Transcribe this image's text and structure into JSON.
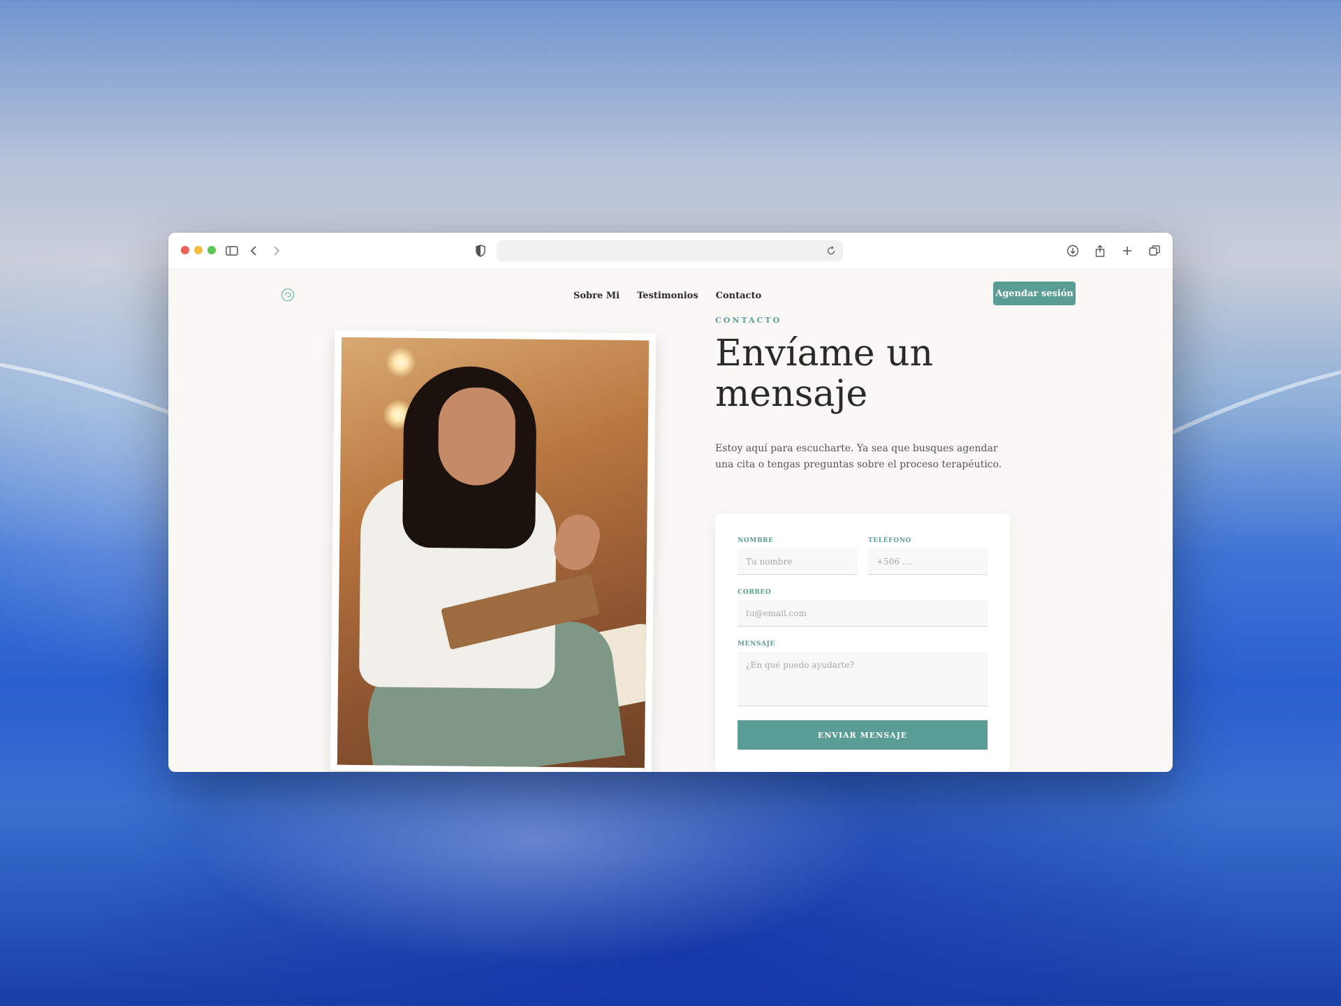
{
  "browser": {
    "url": "",
    "icons": [
      "sidebar-icon",
      "back-icon",
      "forward-icon",
      "shield-icon",
      "reload-icon",
      "download-icon",
      "share-icon",
      "new-tab-icon",
      "tabs-overview-icon"
    ]
  },
  "site": {
    "nav": [
      "Sobre Mi",
      "Testimonios",
      "Contacto"
    ],
    "cta_label": "Agendar sesión",
    "brand_color": "#5a9d95"
  },
  "contact": {
    "kicker": "CONTACTO",
    "title": "Envíame un mensaje",
    "intro": "Estoy aquí para escucharte. Ya sea que busques agendar una cita o tengas preguntas sobre el proceso terapéutico."
  },
  "form": {
    "name": {
      "label": "NOMBRE",
      "placeholder": "Tu nombre",
      "value": ""
    },
    "phone": {
      "label": "TELÉFONO",
      "placeholder": "+506 ....",
      "value": ""
    },
    "email": {
      "label": "CORREO",
      "placeholder": "tu@email.com",
      "value": ""
    },
    "message": {
      "label": "MENSAJE",
      "placeholder": "¿En qué puedo ayudarte?",
      "value": ""
    },
    "submit_label": "ENVIAR MENSAJE"
  }
}
